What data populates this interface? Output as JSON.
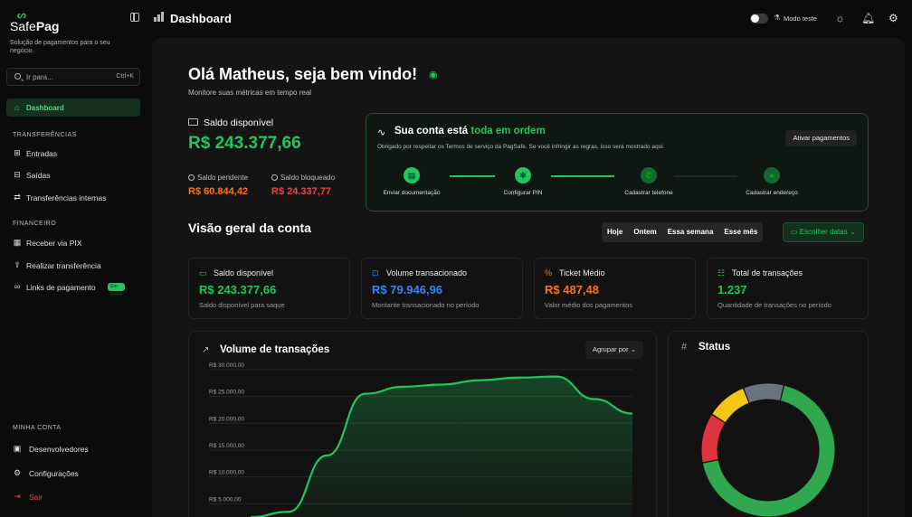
{
  "sidebar": {
    "logo_prefix": "Safe",
    "logo_suffix": "Pag",
    "tagline": "Solução de pagamentos para o seu negócio.",
    "search_placeholder": "Ir para...",
    "search_shortcut": "Ctrl+K",
    "dashboard_label": "Dashboard",
    "section_transfers": "TRANSFERÊNCIAS",
    "entradas": "Entradas",
    "saidas": "Saídas",
    "internas": "Transferências internas",
    "section_finance": "FINANCEIRO",
    "pix": "Receber via PIX",
    "transfer": "Realizar transferência",
    "links": "Links de pagamento",
    "soon_badge": "Em breve",
    "section_account": "MINHA CONTA",
    "devs": "Desenvolvedores",
    "config": "Configurações",
    "logout": "Sair"
  },
  "topbar": {
    "title": "Dashboard",
    "test_mode_label": "Modo teste"
  },
  "main": {
    "greeting": "Olá Matheus, seja bem vindo!",
    "greeting_sub": "Monitore suas métricas em tempo real",
    "balance_label": "Saldo disponível",
    "balance_value": "R$ 243.377,66",
    "pending_label": "Saldo pendente",
    "pending_value": "R$ 60.844,42",
    "blocked_label": "Saldo bloqueado",
    "blocked_value": "R$ 24.337,77"
  },
  "account_status": {
    "title_prefix": "Sua conta está",
    "title_highlight": "toda em ordem",
    "subtitle": "Obrigado por respeitar os Termos de serviço da PagSafe. Se você infringir as regras, isso será mostrado aqui.",
    "button": "Ativar pagamentos",
    "steps": [
      "Enviar documentação",
      "Configurar PIN",
      "Cadastrar telefone",
      "Cadastrar endereço"
    ]
  },
  "overview": {
    "title": "Visão geral da conta",
    "periods": [
      "Hoje",
      "Ontem",
      "Essa semana",
      "Esse mês"
    ],
    "date_button": "Escolher datas",
    "kpis": [
      {
        "label": "Saldo disponível",
        "value": "R$ 243.377,66",
        "desc": "Saldo disponível para saque",
        "color": "#22c55e"
      },
      {
        "label": "Volume transacionado",
        "value": "R$ 79.946,96",
        "desc": "Montante transacionado no período",
        "color": "#3b82f6"
      },
      {
        "label": "Ticket Médio",
        "value": "R$ 487,48",
        "desc": "Valor médio dos pagamentos",
        "color": "#f97316"
      },
      {
        "label": "Total de transações",
        "value": "1.237",
        "desc": "Quantidade de transações no período",
        "color": "#22c55e"
      }
    ]
  },
  "chart_volume": {
    "title": "Volume de transações",
    "group_label": "Agrupar por"
  },
  "chart_data": [
    {
      "type": "area",
      "title": "Volume de transações",
      "ytick_labels": [
        "R$ 30.000,00",
        "R$ 25.000,00",
        "R$ 20.000,00",
        "R$ 15.000,00",
        "R$ 10.000,00",
        "R$ 5.000,00"
      ],
      "yticks": [
        30000,
        25000,
        20000,
        15000,
        10000,
        5000
      ],
      "ylim": [
        0,
        32000
      ],
      "x": [
        0,
        1,
        2,
        3,
        4,
        5,
        6,
        7,
        8,
        9,
        10
      ],
      "values": [
        2500,
        3500,
        14000,
        25500,
        26800,
        27200,
        28000,
        28500,
        28700,
        24500,
        21800
      ],
      "color": "#22c55e",
      "grid": true
    },
    {
      "type": "pie",
      "title": "Status",
      "values": [
        62,
        11,
        9,
        9
      ],
      "colors": [
        "#2fa84f",
        "#e0353f",
        "#f5c518",
        "#6b7280"
      ]
    }
  ],
  "status_card": {
    "title": "Status"
  }
}
